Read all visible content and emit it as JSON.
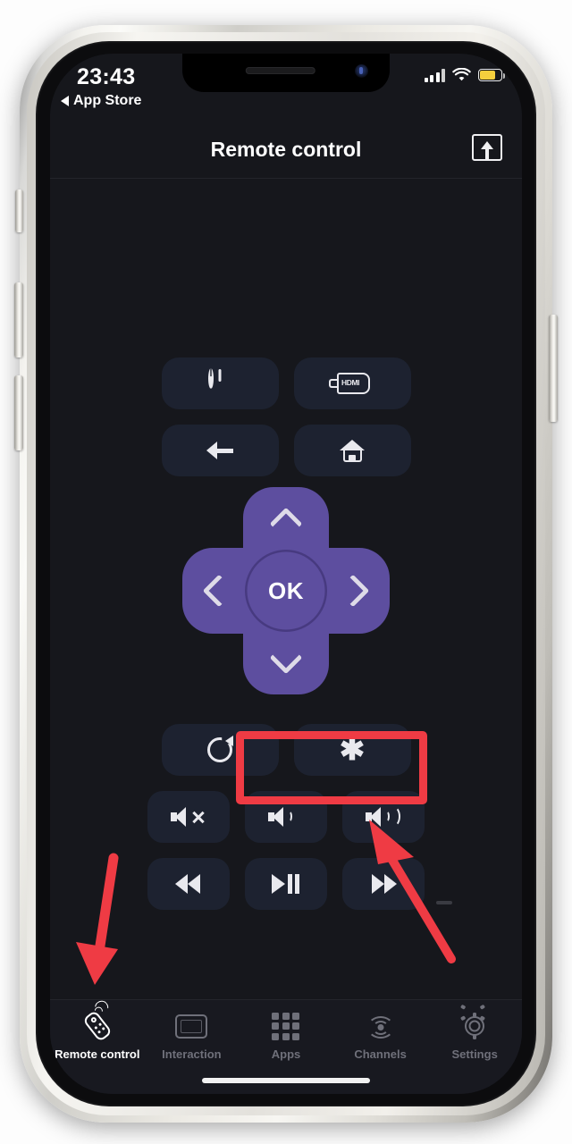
{
  "status_bar": {
    "time": "23:43",
    "back_label": "App Store",
    "signal_icon": "cellular-signal-icon",
    "wifi_icon": "wifi-icon",
    "battery_icon": "battery-icon"
  },
  "header": {
    "title": "Remote control",
    "cast_icon": "airplay-cast-icon"
  },
  "remote": {
    "rows": [
      {
        "keys": [
          {
            "name": "power-button",
            "icon": "power-icon"
          },
          {
            "name": "hdmi-button",
            "icon": "hdmi-icon",
            "label": "HDMI"
          }
        ]
      },
      {
        "keys": [
          {
            "name": "back-button",
            "icon": "back-arrow-icon"
          },
          {
            "name": "home-button",
            "icon": "home-icon"
          }
        ]
      }
    ],
    "dpad": {
      "ok_label": "OK",
      "up": "dpad-up-button",
      "down": "dpad-down-button",
      "left": "dpad-left-button",
      "right": "dpad-right-button",
      "color": "#5d4e9f"
    },
    "control_rows": [
      {
        "keys": [
          {
            "name": "replay-button",
            "icon": "replay-icon"
          },
          {
            "name": "asterisk-button",
            "icon": "asterisk-icon",
            "glyph": "✱"
          }
        ]
      },
      {
        "keys": [
          {
            "name": "mute-button",
            "icon": "volume-mute-icon"
          },
          {
            "name": "volume-down-button",
            "icon": "volume-down-icon"
          },
          {
            "name": "volume-up-button",
            "icon": "volume-up-icon"
          }
        ]
      },
      {
        "keys": [
          {
            "name": "rewind-button",
            "icon": "rewind-icon"
          },
          {
            "name": "play-pause-button",
            "icon": "play-pause-icon"
          },
          {
            "name": "fast-forward-button",
            "icon": "fast-forward-icon"
          }
        ]
      }
    ]
  },
  "tabbar": {
    "items": [
      {
        "label": "Remote control",
        "icon": "remote-icon",
        "active": true
      },
      {
        "label": "Interaction",
        "icon": "screen-icon",
        "active": false
      },
      {
        "label": "Apps",
        "icon": "grid-icon",
        "active": false
      },
      {
        "label": "Channels",
        "icon": "broadcast-icon",
        "active": false
      },
      {
        "label": "Settings",
        "icon": "gear-icon",
        "active": false
      }
    ]
  },
  "annotations": {
    "highlight_color": "#ef3b44",
    "rectangle_target": "volume-down-and-up-buttons",
    "arrow_left_target": "remote-control-tab",
    "arrow_right_target": "fast-forward-button"
  },
  "theme": {
    "screen_bg": "#16171c",
    "key_bg": "#1d2230",
    "accent_purple": "#5d4e9f",
    "text_primary": "#ffffff",
    "text_muted": "#6f707a"
  }
}
